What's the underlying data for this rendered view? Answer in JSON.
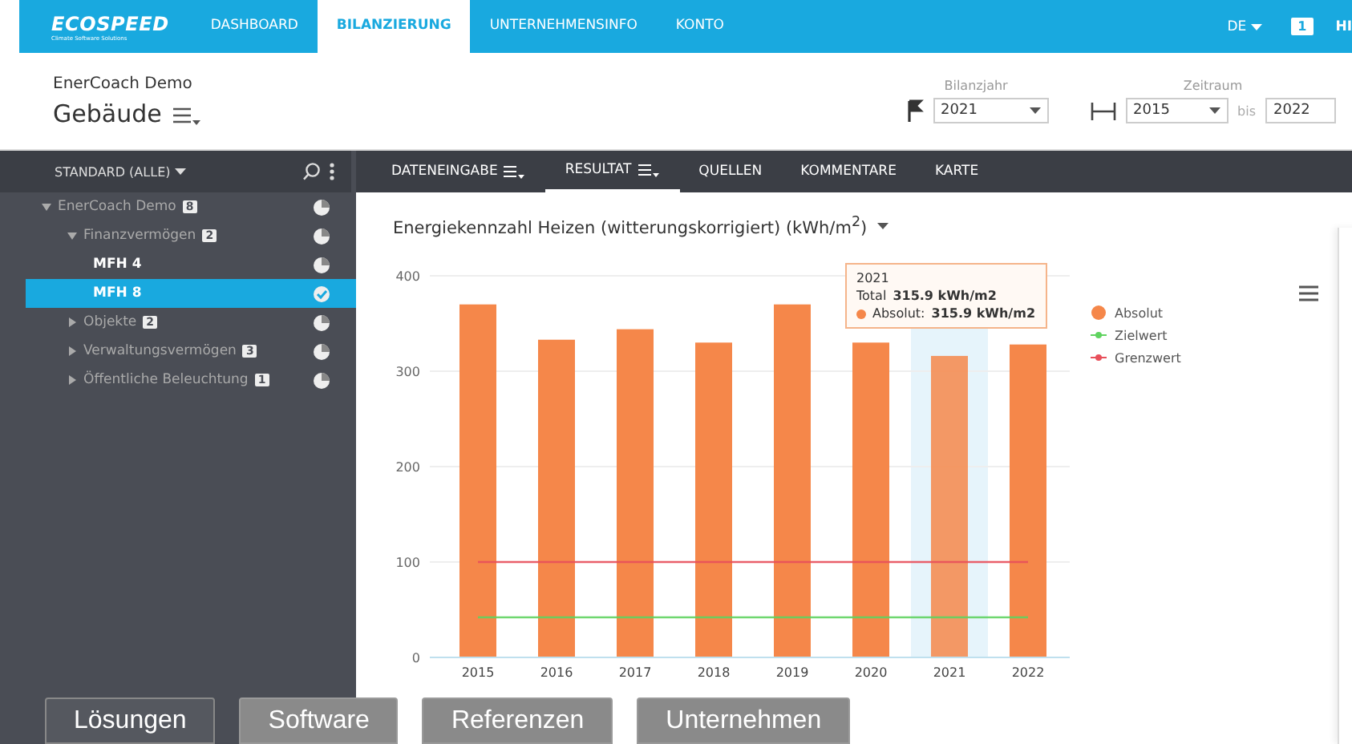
{
  "topbar": {
    "logo": "ECOSPEED",
    "logo_sub": "Climate Software Solutions",
    "nav": [
      {
        "label": "DASHBOARD",
        "selected": false
      },
      {
        "label": "BILANZIERUNG",
        "selected": true
      },
      {
        "label": "UNTERNEHMENSINFO",
        "selected": false
      },
      {
        "label": "KONTO",
        "selected": false
      }
    ],
    "language": "DE",
    "notifications": "1",
    "user": "HI"
  },
  "header": {
    "subtitle": "EnerCoach Demo",
    "title": "Gebäude",
    "year_label": "Bilanzjahr",
    "year": "2021",
    "period_label": "Zeitraum",
    "period_from": "2015",
    "period_sep": "bis",
    "period_to": "2022"
  },
  "sidebar": {
    "filter": "STANDARD (ALLE)",
    "tree": [
      {
        "label": "EnerCoach Demo",
        "count": "8",
        "expanded": true,
        "selected": false,
        "children": [
          {
            "label": "Finanzvermögen",
            "count": "2",
            "expanded": true,
            "selected": false,
            "children": [
              {
                "label": "MFH 4",
                "selected": false
              },
              {
                "label": "MFH 8",
                "selected": true
              }
            ]
          },
          {
            "label": "Objekte",
            "count": "2",
            "expanded": false,
            "selected": false
          },
          {
            "label": "Verwaltungsvermögen",
            "count": "3",
            "expanded": false,
            "selected": false
          },
          {
            "label": "Öffentliche Beleuchtung",
            "count": "1",
            "expanded": false,
            "selected": false
          }
        ]
      }
    ]
  },
  "tabs": [
    {
      "label": "DATENEINGABE",
      "menu": true,
      "selected": false
    },
    {
      "label": "RESULTAT",
      "menu": true,
      "selected": true
    },
    {
      "label": "QUELLEN",
      "menu": false,
      "selected": false
    },
    {
      "label": "KOMMENTARE",
      "menu": false,
      "selected": false
    },
    {
      "label": "KARTE",
      "menu": false,
      "selected": false
    }
  ],
  "chart": {
    "title": "Energiekennzahl Heizen (witterungskorrigiert) (kWh/m$^{2}$)",
    "tooltip": {
      "year": "2021",
      "total_label": "Total",
      "total": "315.9 kWh/m2",
      "series_label": "Absolut:",
      "series_value": "315.9 kWh/m2"
    },
    "chart_data": {
      "type": "bar",
      "categories": [
        "2015",
        "2016",
        "2017",
        "2018",
        "2019",
        "2020",
        "2021",
        "2022"
      ],
      "grid": true,
      "ylim": [
        0,
        400
      ],
      "yticks": [
        0,
        100,
        200,
        300,
        400
      ],
      "series": [
        {
          "name": "Absolut",
          "type": "bar",
          "color": "#f5874a",
          "values": [
            370,
            333,
            344,
            330,
            370,
            330,
            316,
            328
          ]
        },
        {
          "name": "Zielwert",
          "type": "line",
          "color": "#5fd35f",
          "values": [
            42,
            42,
            42,
            42,
            42,
            42,
            42,
            42
          ]
        },
        {
          "name": "Grenzwert",
          "type": "line",
          "color": "#e8505b",
          "values": [
            100,
            100,
            100,
            100,
            100,
            100,
            100,
            100
          ]
        }
      ]
    }
  },
  "overlay_buttons": [
    {
      "label": "Lösungen",
      "selected": true
    },
    {
      "label": "Software",
      "selected": false
    },
    {
      "label": "Referenzen",
      "selected": false
    },
    {
      "label": "Unternehmen",
      "selected": false
    }
  ]
}
